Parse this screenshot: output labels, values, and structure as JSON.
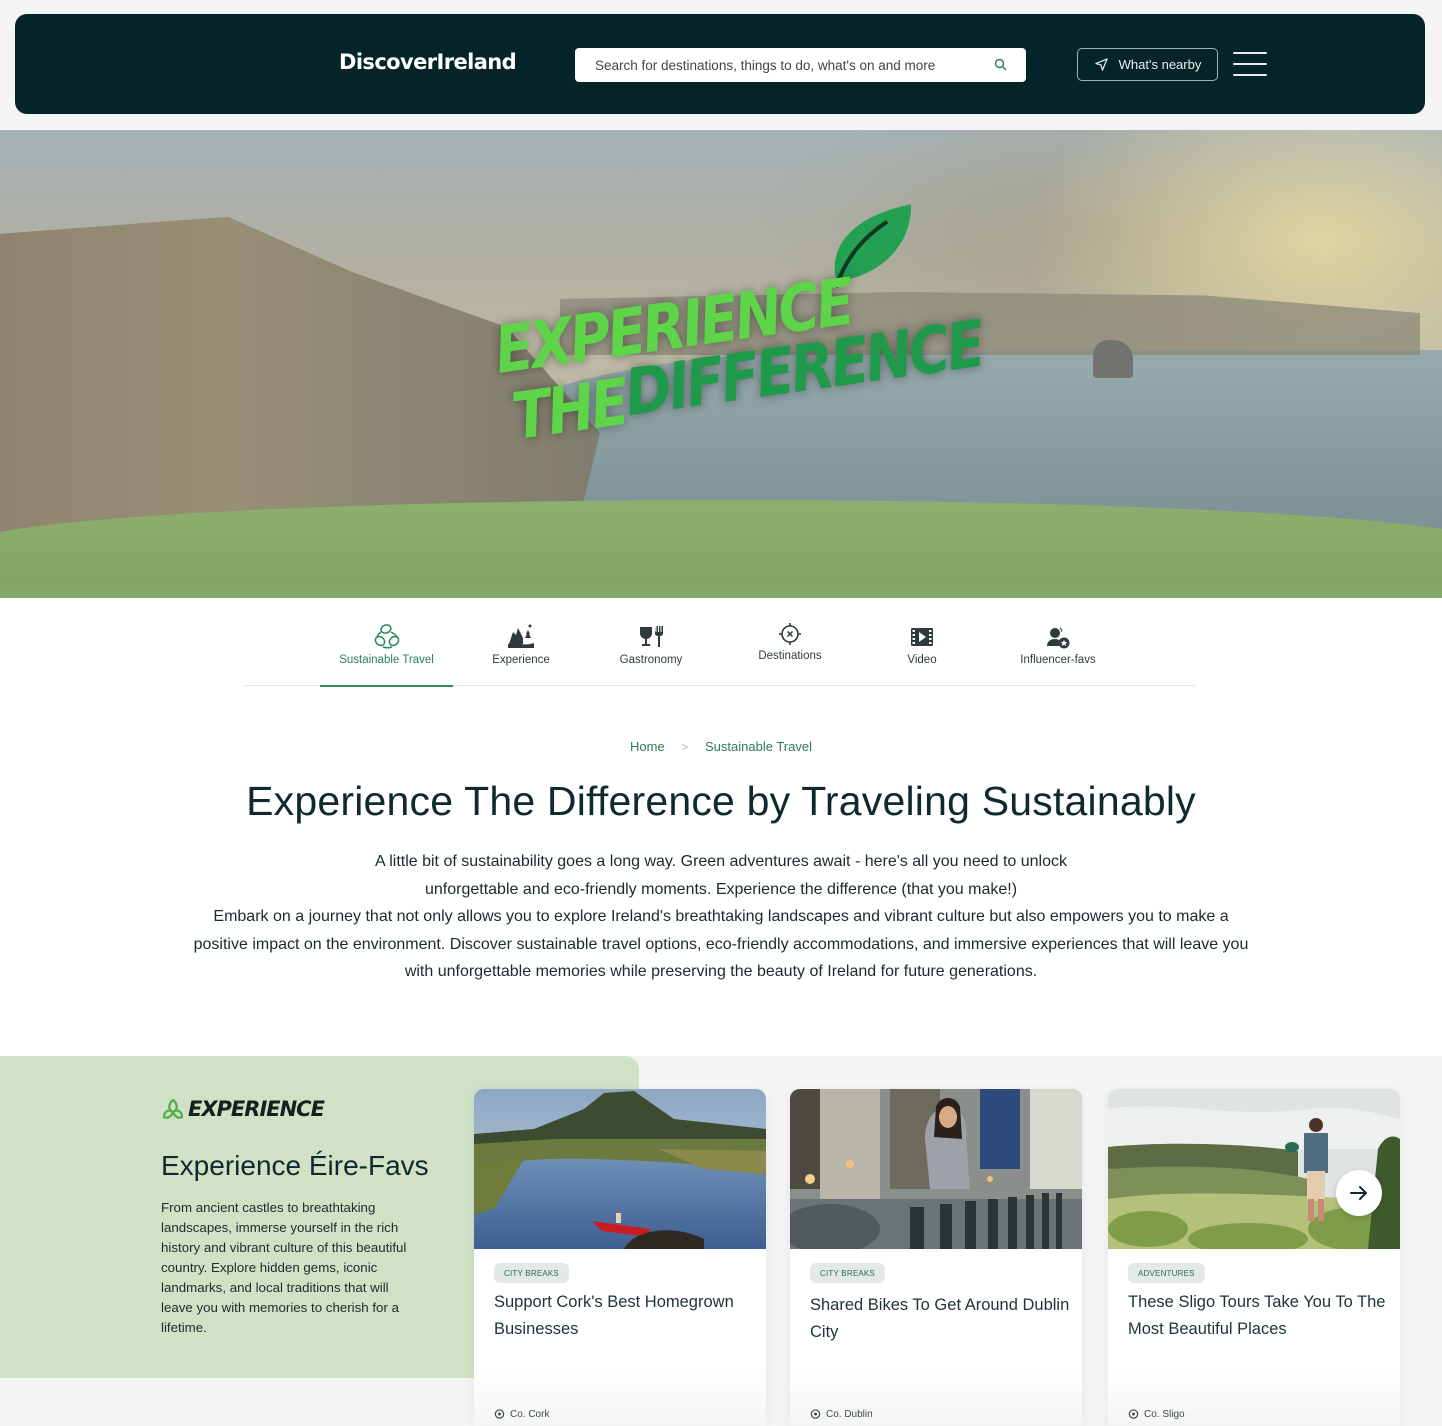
{
  "header": {
    "logo": "DiscoverIreland",
    "search_placeholder": "Search for destinations, things to do, what's on and more",
    "search_value": "",
    "nearby_label": "What's nearby",
    "bg_color": "#04242a"
  },
  "hero": {
    "line1": "EXPERIENCE",
    "line2a": "THE",
    "line2b": "DIFFERENCE",
    "accent_light": "#5ed448",
    "accent_dark": "#1f9a4a"
  },
  "categories": [
    {
      "label": "Sustainable Travel",
      "icon": "recycle-leaves-icon",
      "active": true
    },
    {
      "label": "Experience",
      "icon": "landscape-icon",
      "active": false
    },
    {
      "label": "Gastronomy",
      "icon": "wine-fork-icon",
      "active": false
    },
    {
      "label": "Destinations",
      "icon": "crosshair-icon",
      "active": false
    },
    {
      "label": "Video",
      "icon": "film-play-icon",
      "active": false
    },
    {
      "label": "Influencer-favs",
      "icon": "user-star-icon",
      "active": false
    }
  ],
  "breadcrumb": {
    "home": "Home",
    "separator": ">",
    "current": "Sustainable Travel"
  },
  "main": {
    "title": "Experience The Difference by Traveling Sustainably",
    "intro_line1": "A little bit of sustainability goes a long way. Green adventures await - here's all you need to unlock",
    "intro_line2": "unforgettable and eco-friendly moments. Experience the difference (that you make!)",
    "intro_para2": "Embark on a journey that not only allows you to explore Ireland's breathtaking landscapes and vibrant culture but also empowers you to make a positive impact on the environment. Discover sustainable travel options, eco-friendly accommodations, and immersive experiences that will leave you with unforgettable memories while preserving the beauty of Ireland for future generations."
  },
  "experience": {
    "tag": "EXPERIENCE",
    "title": "Experience Éire-Favs",
    "description": "From ancient castles to breathtaking landscapes, immerse yourself in the rich history and vibrant culture of this beautiful country. Explore hidden gems, iconic landmarks, and local traditions that will leave you with memories to cherish for a lifetime.",
    "panel_color": "#d0e1c6",
    "cards": [
      {
        "badge": "CITY BREAKS",
        "title": "Support Cork's Best Homegrown Businesses",
        "location": "Co. Cork",
        "image": "river-canoe-photo"
      },
      {
        "badge": "CITY BREAKS",
        "title": "Shared Bikes To Get Around Dublin City",
        "location": "Co. Dublin",
        "image": "dublin-bikes-photo"
      },
      {
        "badge": "ADVENTURES",
        "title": "These Sligo Tours Take You To The Most Beautiful Places",
        "location": "Co. Sligo",
        "image": "sligo-hiker-photo"
      }
    ]
  }
}
